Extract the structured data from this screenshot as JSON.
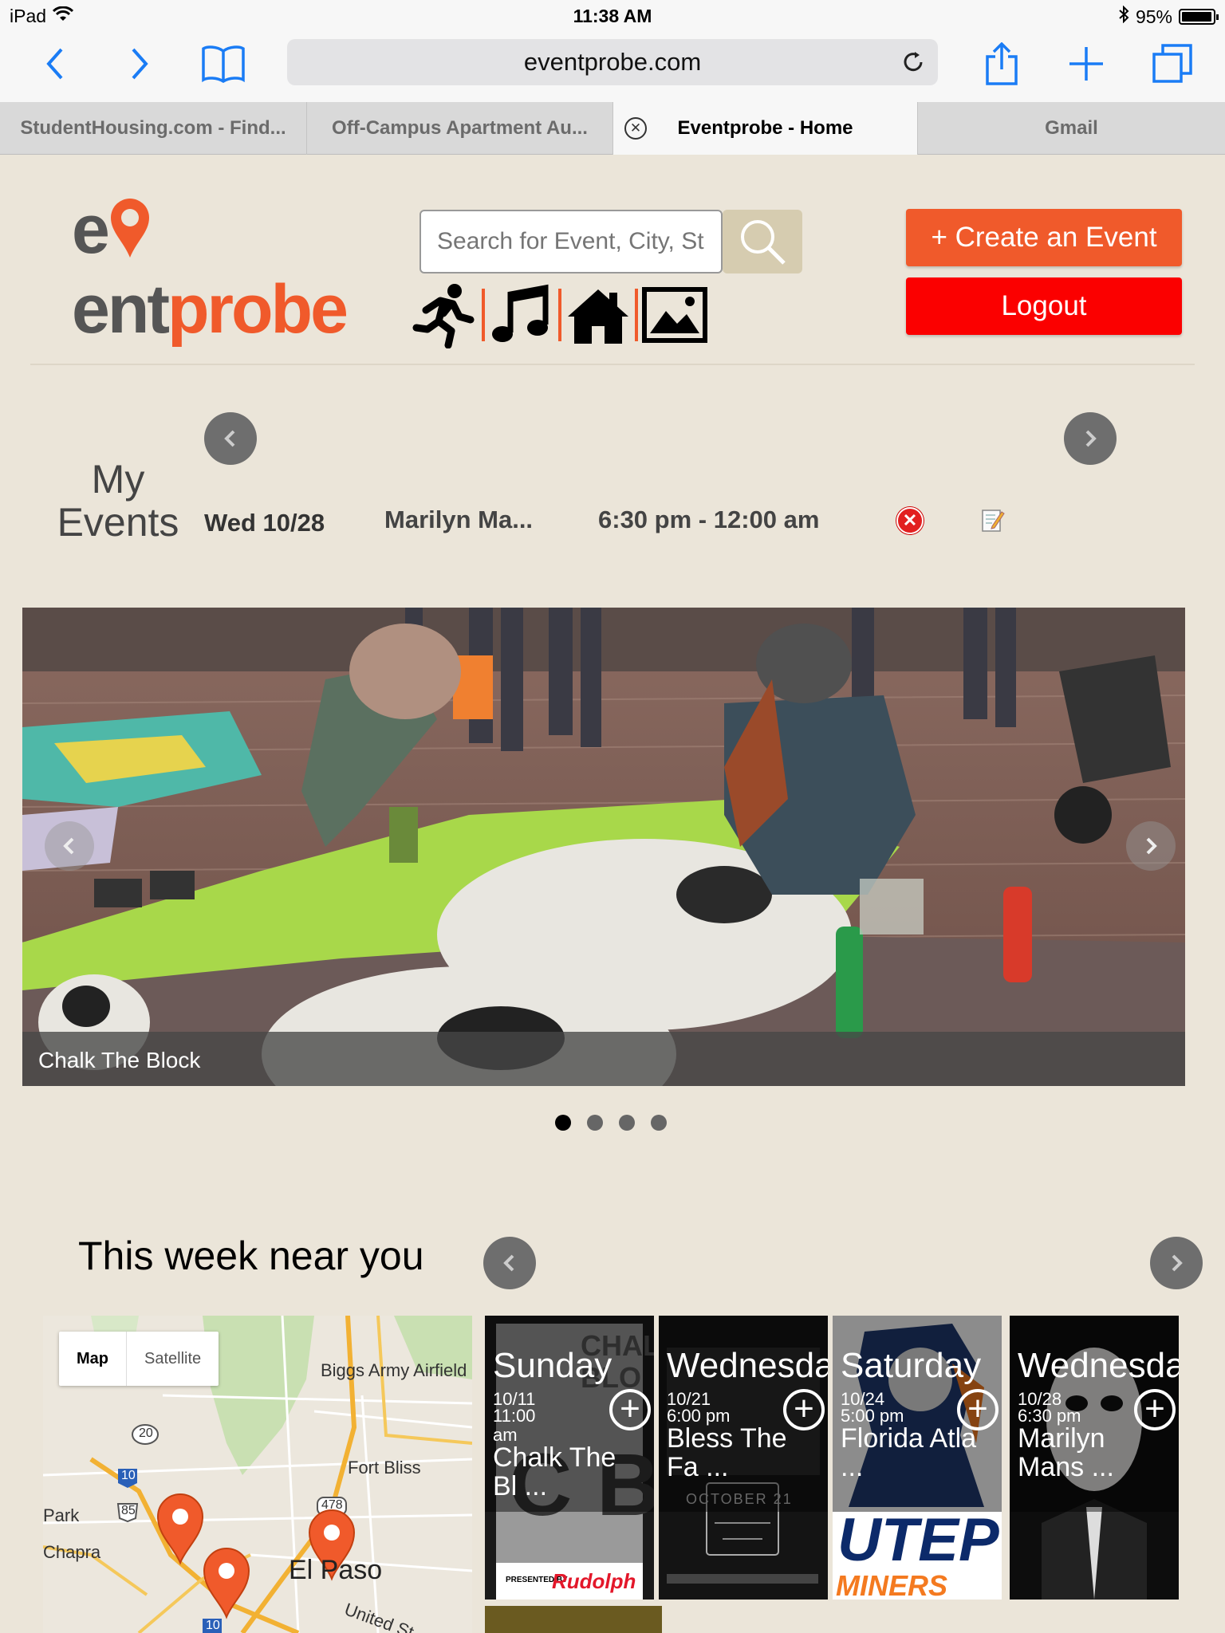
{
  "status_bar": {
    "device": "iPad",
    "time": "11:38 AM",
    "battery": "95%",
    "battery_level": 0.95
  },
  "browser": {
    "url": "eventprobe.com",
    "tabs": [
      {
        "label": "StudentHousing.com - Find...",
        "active": false
      },
      {
        "label": "Off-Campus Apartment Au...",
        "active": false
      },
      {
        "label": "Eventprobe - Home",
        "active": true
      },
      {
        "label": "Gmail",
        "active": false
      }
    ]
  },
  "header": {
    "logo_text": {
      "part1": "e",
      "part2": "ent",
      "part3": "probe"
    },
    "search_placeholder": "Search for Event, City, State",
    "create_button": "+ Create an Event",
    "logout_button": "Logout",
    "categories": [
      "sports-icon",
      "music-icon",
      "home-icon",
      "art-icon"
    ]
  },
  "my_events": {
    "title": "My Events",
    "items": [
      {
        "date": "Wed 10/28",
        "name": "Marilyn Ma...",
        "time": "6:30 pm - 12:00 am"
      }
    ]
  },
  "carousel": {
    "caption": "Chalk The Block",
    "slide_count": 4,
    "active_slide": 1
  },
  "this_week": {
    "title": "This week near you",
    "map": {
      "toggle_map": "Map",
      "toggle_satellite": "Satellite",
      "labels": {
        "biggs": "Biggs Army Airfield",
        "fort_bliss": "Fort Bliss",
        "el_paso": "El Paso",
        "park": "Park",
        "chapra": "Chapra",
        "united": "United St",
        "r20": "20",
        "r10a": "10",
        "r85": "85",
        "r478": "478",
        "r10b": "10"
      }
    },
    "events": [
      {
        "day": "Sunday",
        "date": "10/11",
        "time": "11:00 am",
        "title": "Chalk The Bl ..."
      },
      {
        "day": "Wednesday",
        "date": "10/21",
        "time": "6:00 pm",
        "title": "Bless The Fa ..."
      },
      {
        "day": "Saturday",
        "date": "10/24",
        "time": "5:00 pm",
        "title": "Florida Atla ..."
      },
      {
        "day": "Wednesday",
        "date": "10/28",
        "time": "6:30 pm",
        "title": "Marilyn Mans ..."
      }
    ],
    "poster_text": {
      "chalk_presented": "PRESENTED BY",
      "chalk_sponsor": "Rudolph",
      "bless_date": "OCTOBER 21",
      "utep": "UTEP",
      "miners": "MINERS"
    }
  },
  "colors": {
    "brand_orange": "#f05a2b",
    "logout_red": "#fb0000",
    "page_bg": "#ebe5d9"
  }
}
